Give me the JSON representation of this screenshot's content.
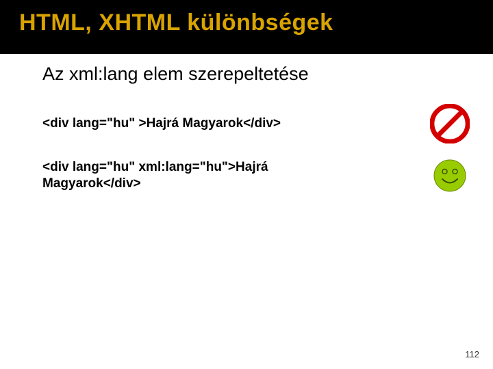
{
  "title": "HTML, XHTML különbségek",
  "subtitle": "Az xml:lang elem szerepeltetése",
  "examples": [
    {
      "code": "<div lang=\"hu\" >Hajrá Magyarok</div>",
      "status": "invalid"
    },
    {
      "code": "<div lang=\"hu\" xml:lang=\"hu\">Hajrá Magyarok</div>",
      "status": "valid"
    }
  ],
  "page_number": "112"
}
